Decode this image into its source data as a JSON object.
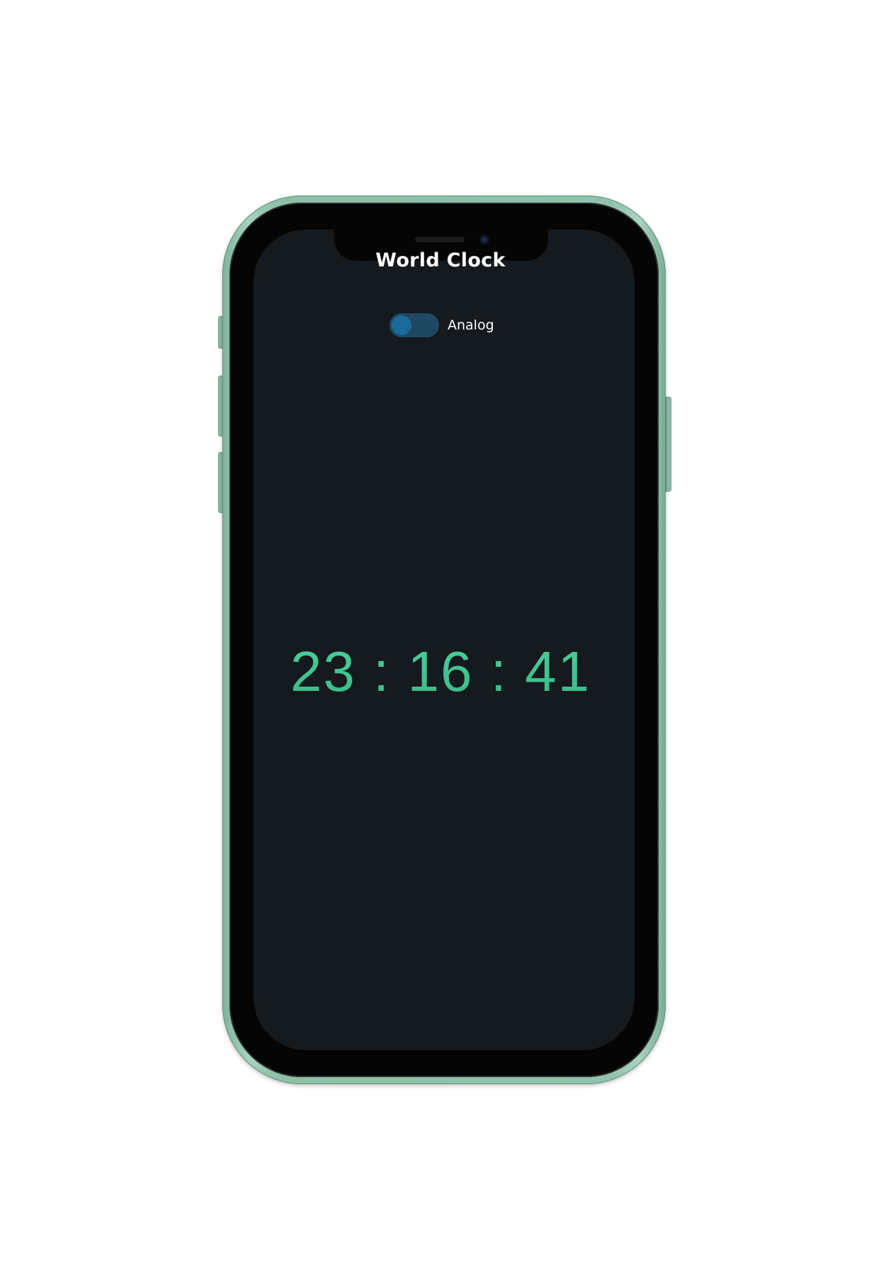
{
  "app": {
    "title": "World Clock",
    "toggle_label": "Analog",
    "toggle_state": "off"
  },
  "clock": {
    "time_text": "23 : 16 : 41",
    "color": "#3fc48f"
  },
  "theme": {
    "screen_background": "#151a1e",
    "phone_color": "#92c2ad",
    "toggle_track": "#1f4862",
    "toggle_knob": "#1a6a9a"
  }
}
